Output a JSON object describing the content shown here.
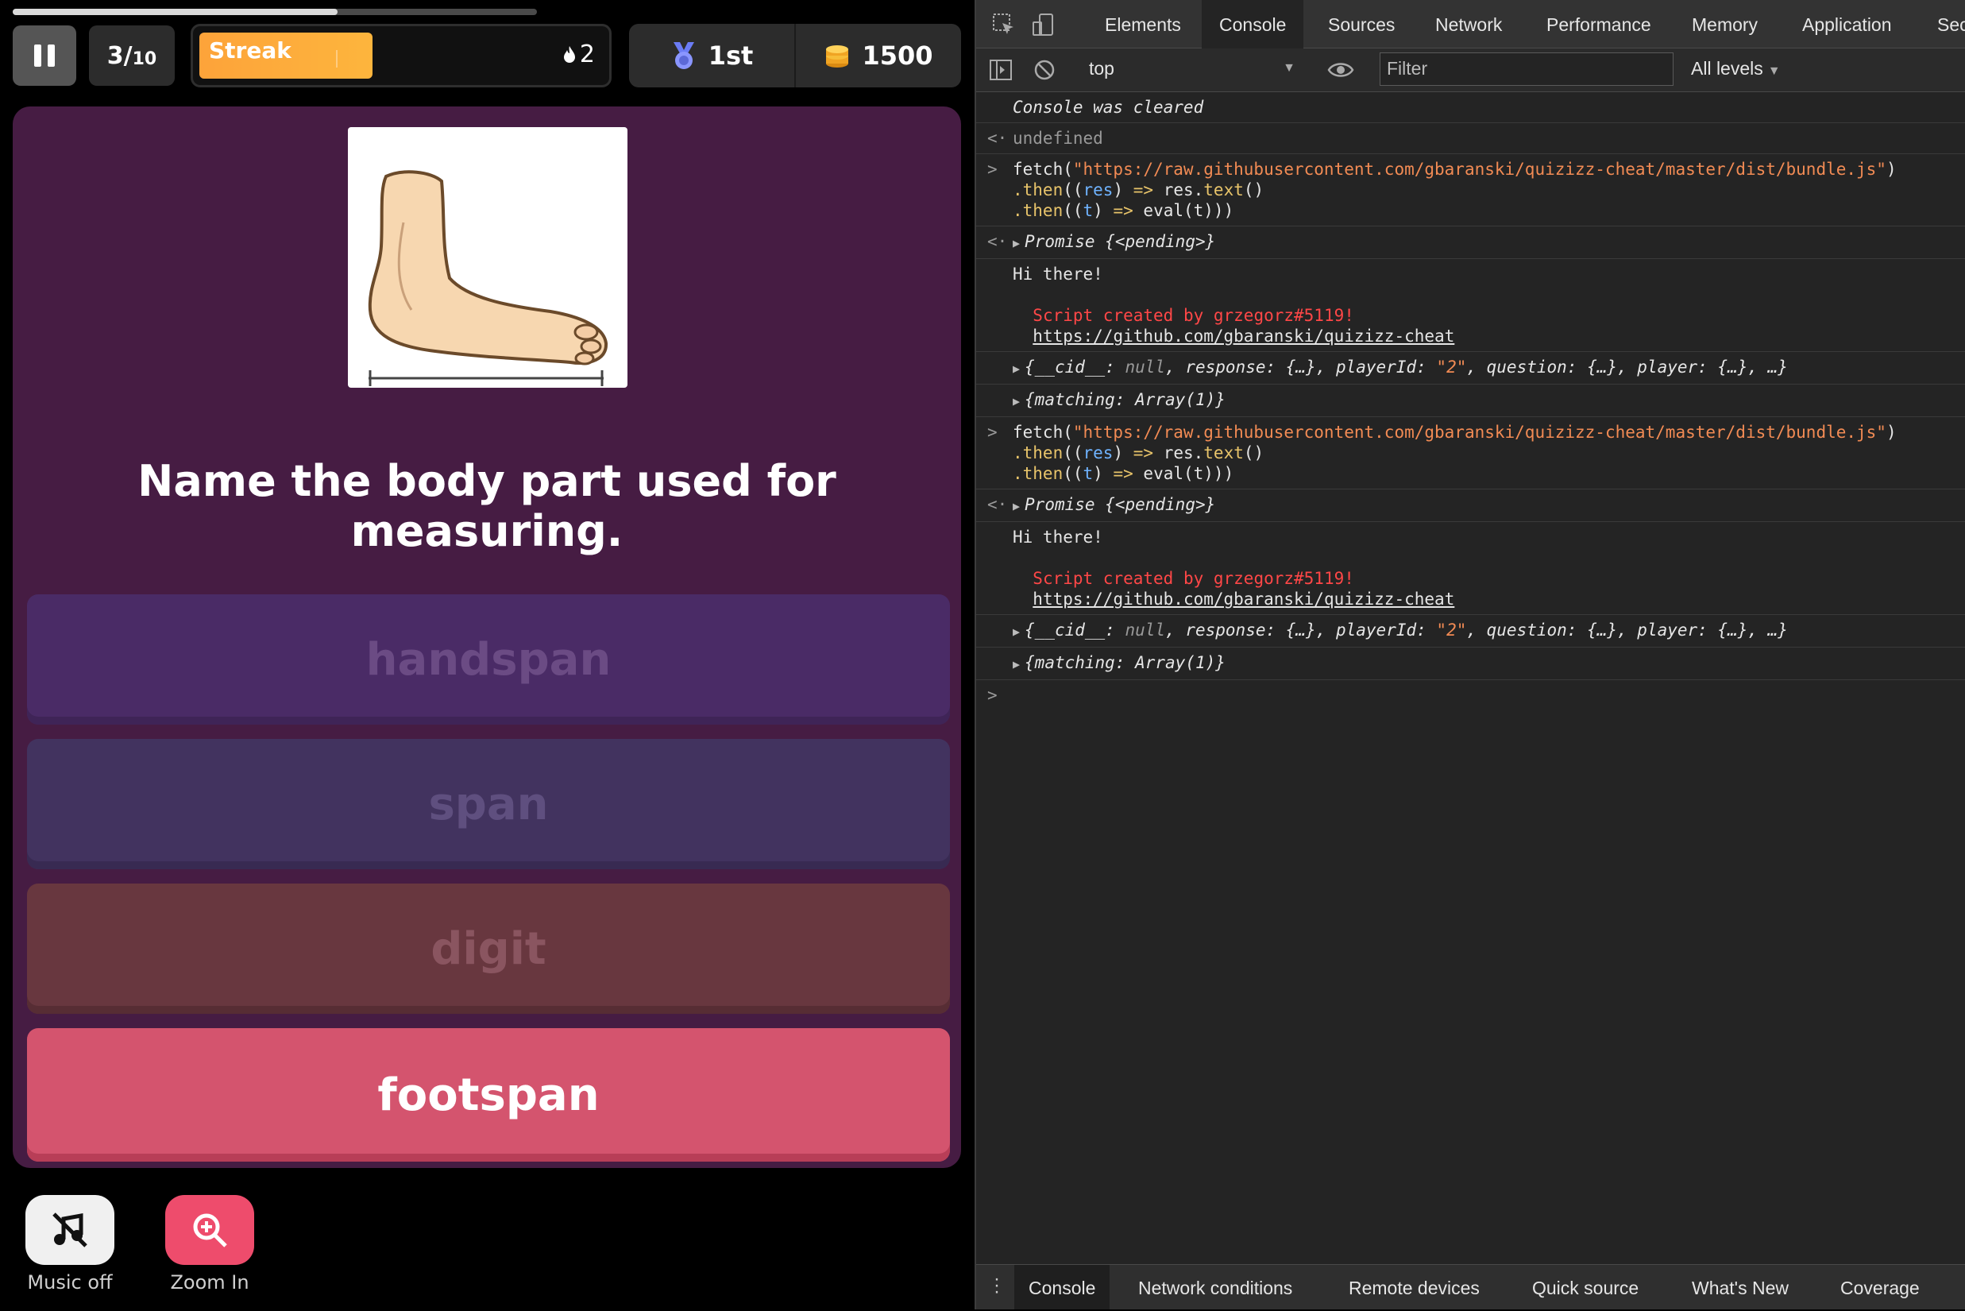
{
  "quiz": {
    "progress_fraction": 0.62,
    "counter": {
      "current": "3",
      "slash": "/",
      "total": "10"
    },
    "streak": {
      "label": "Streak",
      "count": "2",
      "fill_fraction": 0.43
    },
    "rank": "1st",
    "coins": "1500",
    "question": "Name the body part used for measuring.",
    "options": [
      "handspan",
      "span",
      "digit",
      "footspan"
    ],
    "music_label": "Music off",
    "zoom_label": "Zoom In",
    "colors": {
      "card": "#461c43",
      "correct": "#d4546e",
      "streak": "#fdb53d"
    }
  },
  "devtools": {
    "tabs": [
      "Elements",
      "Console",
      "Sources",
      "Network",
      "Performance",
      "Memory",
      "Application",
      "Sec"
    ],
    "context": "top",
    "filter_placeholder": "Filter",
    "levels": "All levels",
    "console": {
      "cleared": "Console was cleared",
      "undefined": "undefined",
      "fetch_fn": "fetch(",
      "url": "\"https://raw.githubusercontent.com/gbaranski/quizizz-cheat/master/dist/bundle.js\"",
      "close_paren": ")",
      "then": ".then",
      "res": "res",
      "t": "t",
      "arrow": "=>",
      "res_text": "res.",
      "text_fn": "text",
      "eval": "eval(t)))",
      "promise": "Promise {<pending>}",
      "hi": "Hi there!",
      "created": "Script created by grzegorz#5119!",
      "link": "https://github.com/gbaranski/quizizz-cheat",
      "obj_cid": "{__cid__: ",
      "null": "null",
      "obj_mid": ", response: {…}, playerId: ",
      "player_id": "\"2\"",
      "obj_end": ", question: {…}, player: {…}, …}",
      "matching": "{matching: Array(1)}"
    },
    "drawer_tabs": [
      "Console",
      "Network conditions",
      "Remote devices",
      "Quick source",
      "What's New",
      "Coverage"
    ]
  }
}
